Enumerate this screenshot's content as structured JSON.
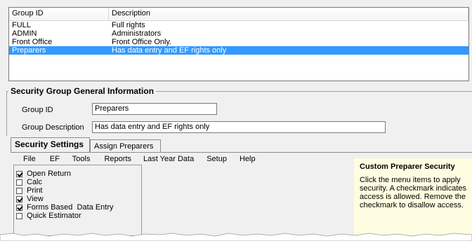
{
  "list": {
    "columns": {
      "group_id": "Group ID",
      "description": "Description"
    },
    "rows": [
      {
        "group_id": "FULL",
        "description": "Full rights"
      },
      {
        "group_id": "ADMIN",
        "description": "Administrators"
      },
      {
        "group_id": "Front Office",
        "description": "Front Office Only."
      },
      {
        "group_id": "Preparers",
        "description": "Has data entry and EF rights only"
      }
    ],
    "selected_index": 3
  },
  "info": {
    "legend": "Security Group General Information",
    "group_id_label": "Group ID",
    "group_id_value": "Preparers",
    "group_description_label": "Group Description",
    "group_description_value": "Has data entry and EF rights only"
  },
  "tabs": [
    {
      "label": "Security Settings",
      "active": true
    },
    {
      "label": "Assign Preparers",
      "active": false
    }
  ],
  "menu": [
    "File",
    "EF",
    "Tools",
    "Reports",
    "Last Year Data",
    "Setup",
    "Help"
  ],
  "checklist": [
    {
      "label": "Open Return",
      "checked": true
    },
    {
      "label": "Calc",
      "checked": false
    },
    {
      "label": "Print",
      "checked": false
    },
    {
      "label": "View",
      "checked": true
    },
    {
      "label": "Forms Based  Data Entry",
      "checked": true
    },
    {
      "label": "Quick Estimator",
      "checked": false
    }
  ],
  "help": {
    "title": "Custom Preparer Security",
    "body": "Click the menu items to apply security. A checkmark indicates access is allowed. Remove the checkmark to disallow access."
  },
  "colors": {
    "selection": "#3399ff",
    "help_background": "#fffde1",
    "dialog_background": "#f0f0f0"
  }
}
